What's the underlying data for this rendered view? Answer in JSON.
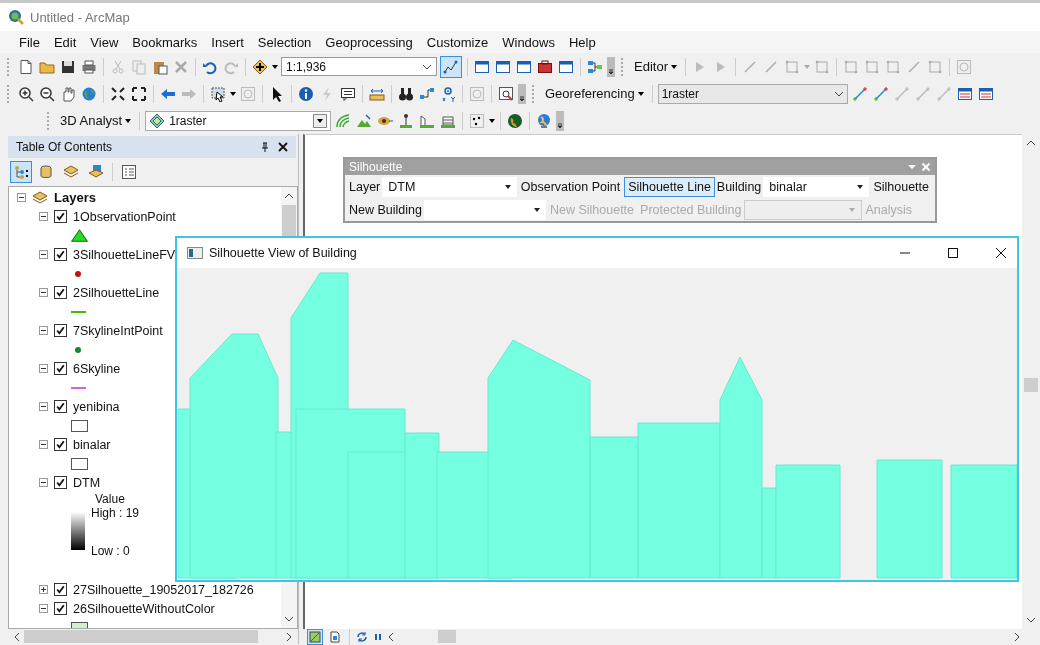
{
  "window": {
    "title": "Untitled - ArcMap"
  },
  "menu": [
    "File",
    "Edit",
    "View",
    "Bookmarks",
    "Insert",
    "Selection",
    "Geoprocessing",
    "Customize",
    "Windows",
    "Help"
  ],
  "toolbars": {
    "scale_field": {
      "value": "1:1,936"
    },
    "edit_tool_selected": true,
    "editor_menu": "Editor",
    "georef_menu": "Georeferencing",
    "georef_layer": "1raster",
    "analyst_menu": "3D Analyst",
    "analyst_layer": "1raster"
  },
  "toc": {
    "title": "Table Of Contents",
    "views": [
      {
        "selected": true
      },
      {
        "selected": false
      },
      {
        "selected": false
      },
      {
        "selected": false
      },
      {
        "selected": false
      }
    ],
    "root": {
      "label": "Layers",
      "expanded": true,
      "children": [
        {
          "label": "1ObservationPoint",
          "checked": true,
          "expanded": true,
          "symbol": {
            "kind": "triangle",
            "color": "#22dd22"
          }
        },
        {
          "label": "3SilhouetteLineFV",
          "checked": true,
          "expanded": true,
          "symbol": {
            "kind": "point",
            "color": "#cc1111"
          }
        },
        {
          "label": "2SilhouetteLine",
          "checked": true,
          "expanded": true,
          "symbol": {
            "kind": "line",
            "color": "#44bb00"
          }
        },
        {
          "label": "7SkylineIntPoint",
          "checked": true,
          "expanded": true,
          "symbol": {
            "kind": "point",
            "color": "#118833"
          }
        },
        {
          "label": "6Skyline",
          "checked": true,
          "expanded": true,
          "symbol": {
            "kind": "line",
            "color": "#cc66dd"
          }
        },
        {
          "label": "yenibina",
          "checked": true,
          "expanded": true,
          "symbol": {
            "kind": "polygon",
            "color": "#ffffff"
          }
        },
        {
          "label": "binalar",
          "checked": true,
          "expanded": true,
          "symbol": {
            "kind": "polygon",
            "color": "#ffffff"
          }
        },
        {
          "label": "DTM",
          "checked": true,
          "expanded": true,
          "symbol": {
            "kind": "ramp",
            "heading": "Value",
            "high": "High : 19",
            "low": "Low : 0"
          }
        },
        {
          "label": "27Silhouette_19052017_182726",
          "checked": true,
          "expanded": false
        },
        {
          "label": "26SilhouetteWithoutColor",
          "checked": true,
          "expanded": true,
          "symbol": {
            "kind": "polygon",
            "color": "#c8f5cc"
          }
        }
      ]
    }
  },
  "silhouette_toolbar": {
    "title": "Silhouette",
    "top_row": [
      {
        "kind": "label",
        "text": "Layer"
      },
      {
        "kind": "combo",
        "value": "DTM",
        "disabled": false
      },
      {
        "kind": "button",
        "text": "Observation Point",
        "disabled": false,
        "selected": false
      },
      {
        "kind": "button",
        "text": "Silhouette Line",
        "disabled": false,
        "selected": true
      },
      {
        "kind": "label",
        "text": "Building"
      },
      {
        "kind": "combo",
        "value": "binalar",
        "disabled": false
      },
      {
        "kind": "button",
        "text": "Silhouette",
        "disabled": false,
        "selected": false
      }
    ],
    "bottom_row": [
      {
        "kind": "label",
        "text": "New Building"
      },
      {
        "kind": "combo",
        "disabled": false
      },
      {
        "kind": "button",
        "text": "New Silhouette",
        "disabled": true,
        "selected": false
      },
      {
        "kind": "label",
        "text": "Protected Building",
        "disabled": true
      },
      {
        "kind": "combo",
        "disabled": true
      },
      {
        "kind": "button",
        "text": "Analysis",
        "disabled": true,
        "selected": false
      }
    ]
  },
  "silhouette_view": {
    "title": "Silhouette View of Building"
  },
  "map_views": [
    {
      "selected": true
    },
    {
      "selected": false
    }
  ]
}
